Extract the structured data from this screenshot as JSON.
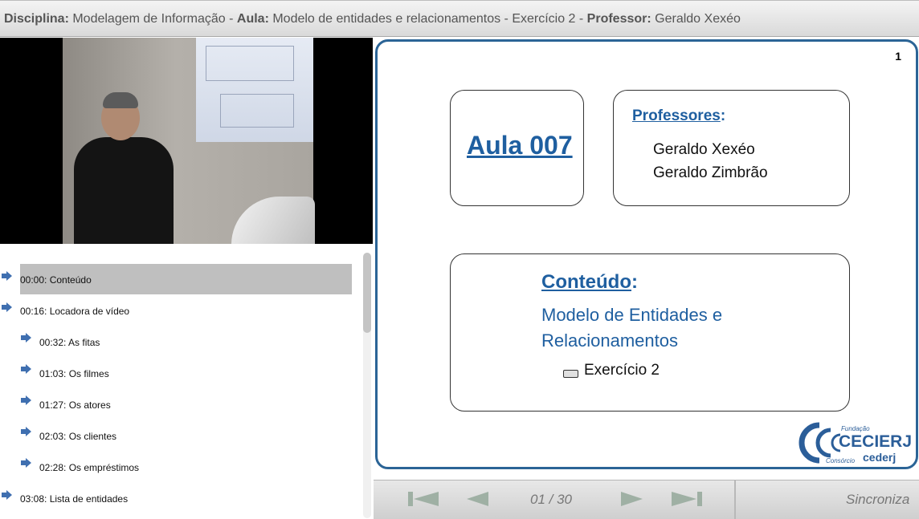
{
  "header": {
    "disciplina_label": "Disciplina:",
    "disciplina_value": " Modelagem de Informação - ",
    "aula_label": "Aula:",
    "aula_value": " Modelo de entidades e relacionamentos - Exercício 2 - ",
    "professor_label": "Professor:",
    "professor_value": " Geraldo Xexéo"
  },
  "toc": {
    "items": [
      {
        "label": "00:00: Conteúdo",
        "level": 0,
        "active": true
      },
      {
        "label": "00:16: Locadora de vídeo",
        "level": 0,
        "active": false
      },
      {
        "label": "00:32: As fitas",
        "level": 1,
        "active": false
      },
      {
        "label": "01:03: Os filmes",
        "level": 1,
        "active": false
      },
      {
        "label": "01:27: Os atores",
        "level": 1,
        "active": false
      },
      {
        "label": "02:03: Os clientes",
        "level": 1,
        "active": false
      },
      {
        "label": "02:28: Os empréstimos",
        "level": 1,
        "active": false
      },
      {
        "label": "03:08: Lista de entidades",
        "level": 0,
        "active": false
      }
    ]
  },
  "slide": {
    "page_number": "1",
    "aula_title": "Aula 007",
    "professores_title": "Professores",
    "professores_colon": ":",
    "professores": [
      "Geraldo Xexéo",
      "Geraldo Zimbrão"
    ],
    "conteudo_title": "Conteúdo",
    "conteudo_colon": ":",
    "conteudo_line1": "Modelo de Entidades e",
    "conteudo_line2": "Relacionamentos",
    "conteudo_sub": "Exercício 2",
    "logo": {
      "fundacao": "Fundação",
      "cecierj": "CECIERJ",
      "consorcio": "Consórcio",
      "cederj": "cederj"
    }
  },
  "controls": {
    "page_counter": "01 / 30",
    "sync_label": "Sincroniza"
  },
  "colors": {
    "accent": "#1f5fa0",
    "slide_border": "#2b6496",
    "control_icon": "#9fb0a4"
  }
}
